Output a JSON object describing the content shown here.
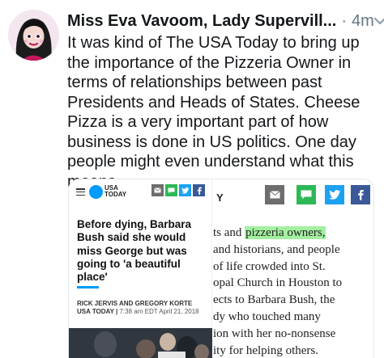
{
  "tweet": {
    "author": "Miss Eva Vavoom, Lady Supervill...",
    "separator": "·",
    "time": "4m",
    "text": "It was kind of The USA Today to bring up the importance of the Pizzeria Owner in terms of relationships between past Presidents and Heads of States. Cheese Pizza is a very important part of how business is done in US politics. One day people might even understand what this means."
  },
  "card": {
    "left": {
      "logo_line1": "USA",
      "logo_line2": "TODAY",
      "headline": "Before dying, Barbara Bush said she would miss George but was going to 'a beautiful place'",
      "byline": "RICK JERVIS AND GREGORY KORTE",
      "source": "USA TODAY",
      "dateline": "7:38 am EDT April 21, 2018",
      "share_icons": [
        "mail-icon",
        "sms-icon",
        "twitter-icon",
        "facebook-icon"
      ]
    },
    "right": {
      "masthead_fragment": "Y",
      "share_icons": [
        "mail-icon",
        "sms-icon",
        "twitter-icon",
        "facebook-icon"
      ],
      "line1_pre": "ts and ",
      "line1_highlight": "pizzeria owners,",
      "lines": [
        "and historians, and people",
        "of life crowded into St.",
        "opal Church in Houston to",
        "ects to Barbara Bush, the",
        "dy who touched many",
        "ion with her no-nonsense",
        "ity for helping others."
      ]
    },
    "colors": {
      "usa_today_blue": "#009bff",
      "icon_gray": "#6d6d6d",
      "sms_green": "#2db856",
      "twitter_blue": "#1da1f2",
      "facebook_blue": "#3b5998",
      "highlight_green": "#a4f0a0"
    }
  }
}
